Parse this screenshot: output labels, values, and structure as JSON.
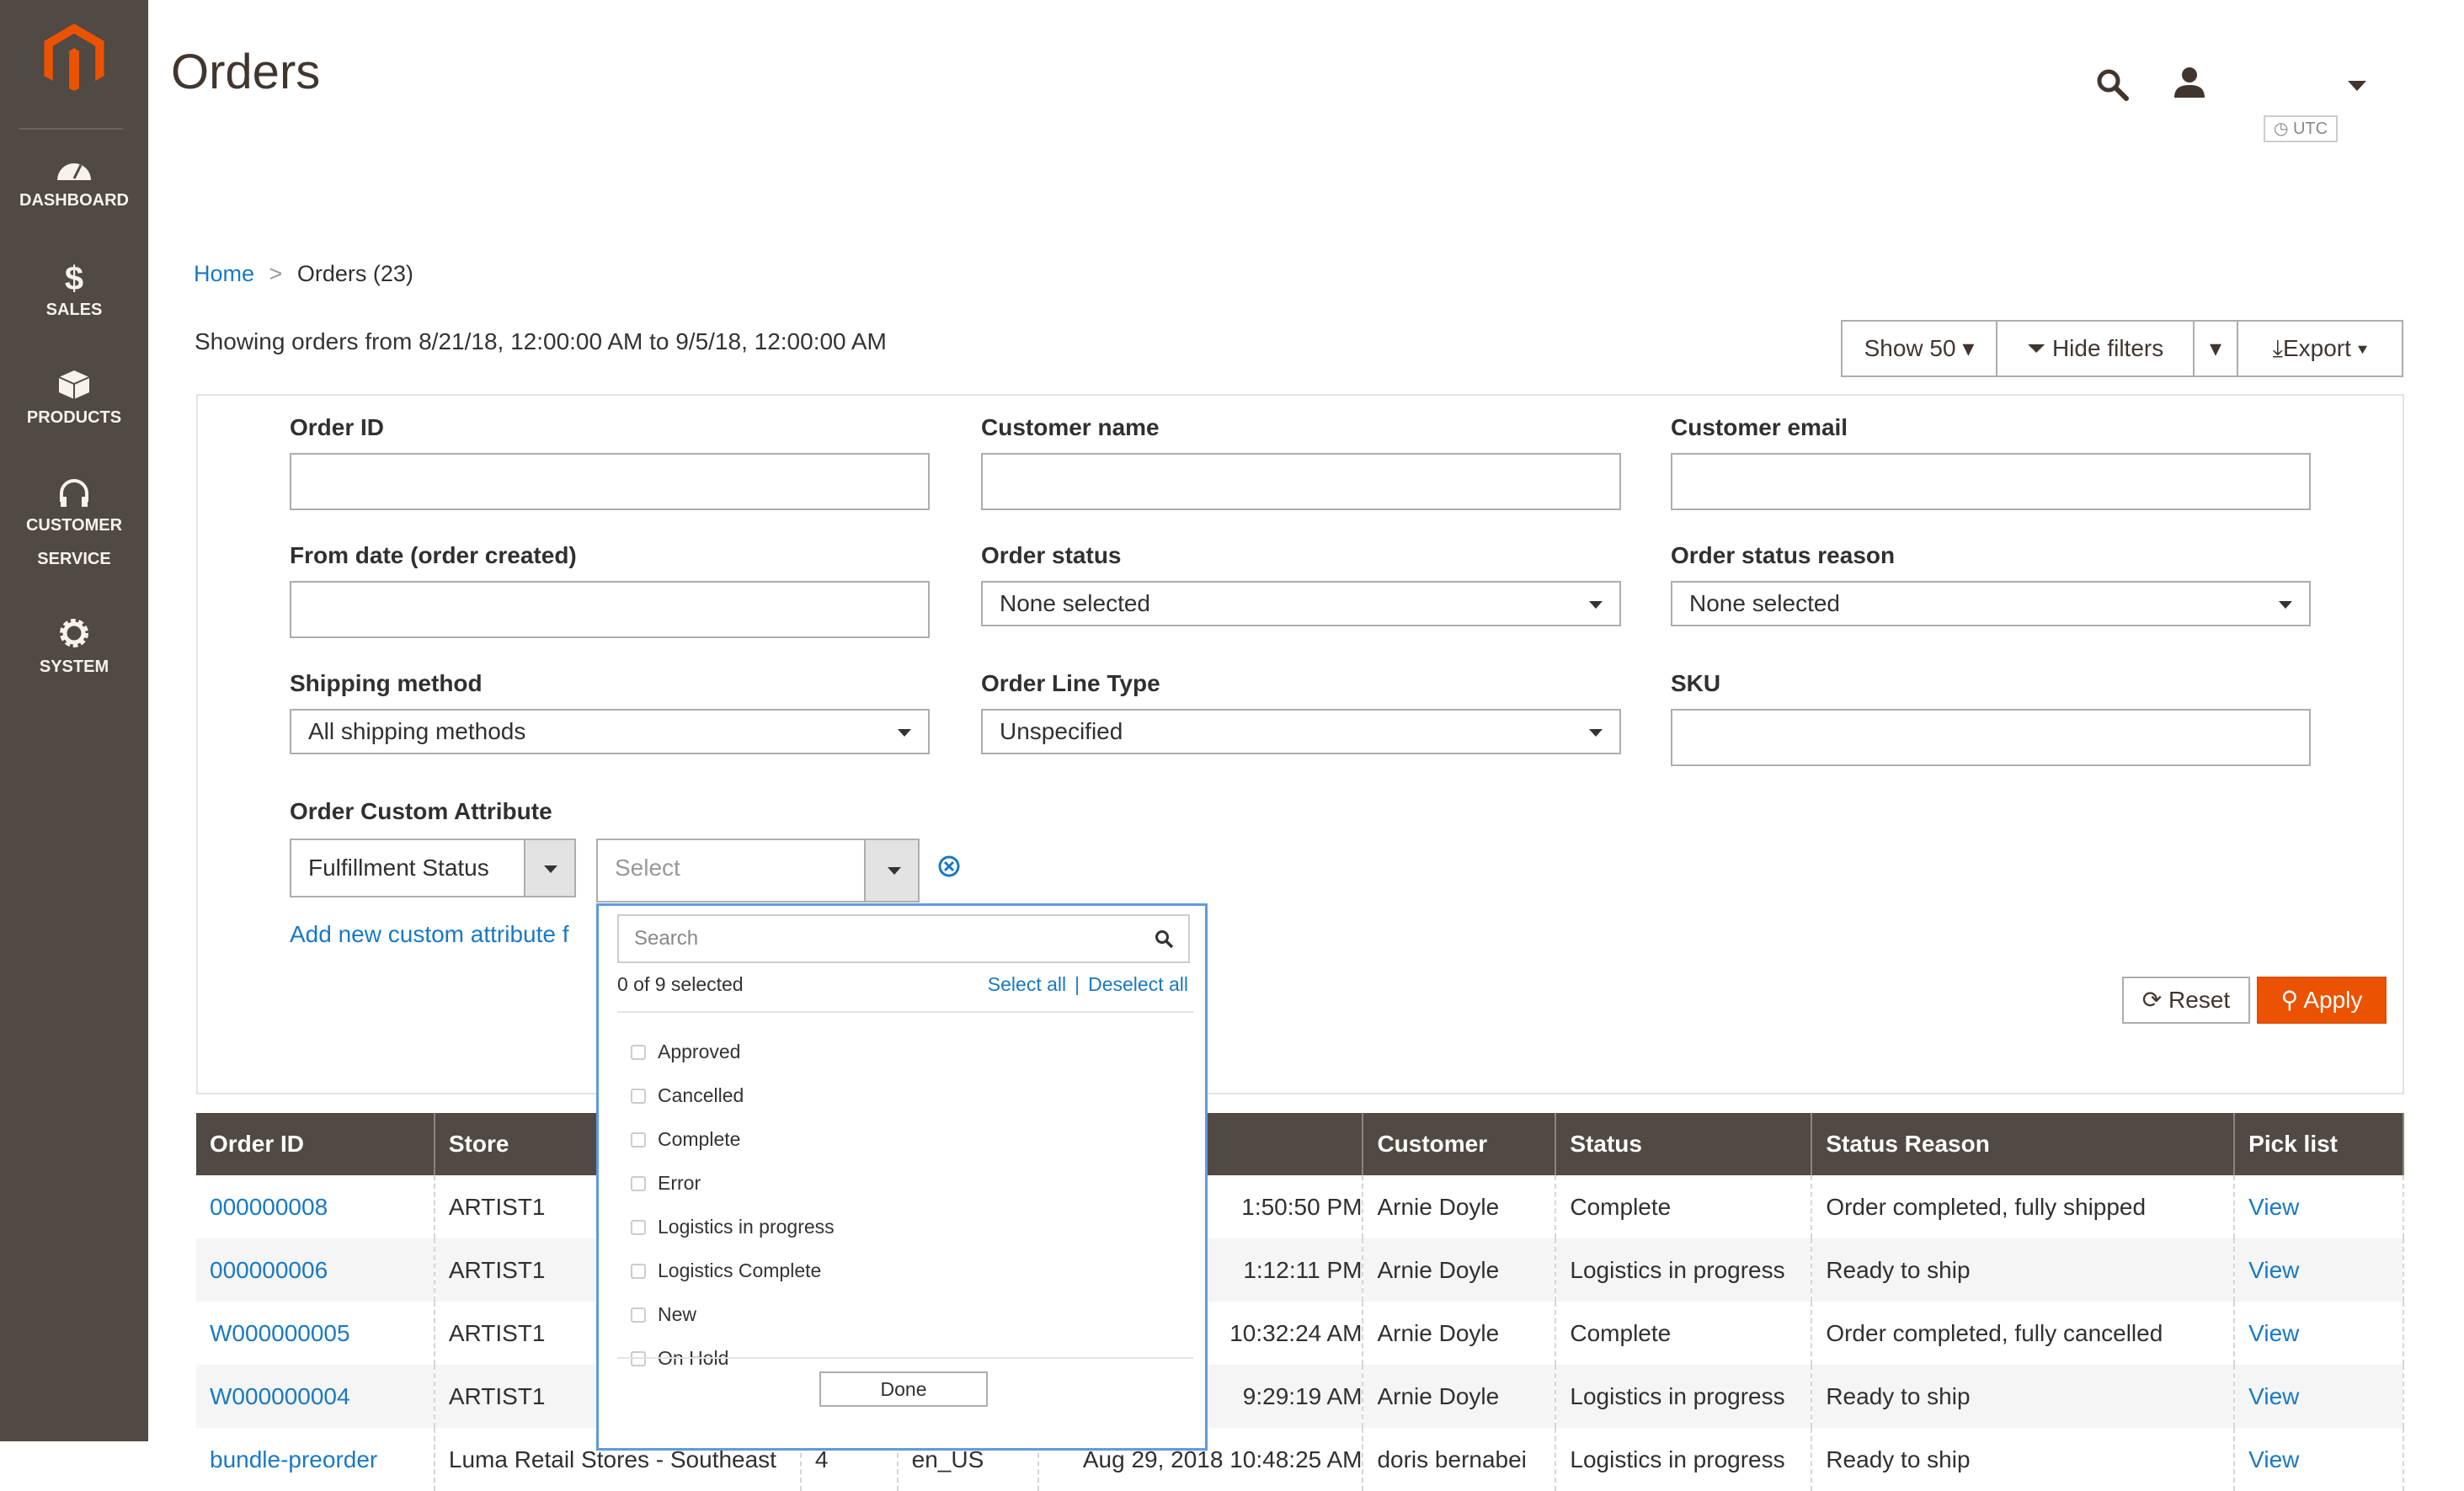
{
  "sidebar": {
    "items": [
      {
        "label": "DASHBOARD",
        "icon": "dashboard-icon"
      },
      {
        "label": "SALES",
        "icon": "dollar-icon"
      },
      {
        "label": "PRODUCTS",
        "icon": "box-icon"
      },
      {
        "label": "CUSTOMER",
        "label2": "SERVICE",
        "icon": "headset-icon"
      },
      {
        "label": "SYSTEM",
        "icon": "gear-icon"
      }
    ]
  },
  "header": {
    "title": "Orders",
    "timezone": "UTC"
  },
  "breadcrumb": {
    "home": "Home",
    "sep": ">",
    "current": "Orders (23)"
  },
  "showing": "Showing orders from 8/21/18, 12:00:00 AM to 9/5/18, 12:00:00 AM",
  "toolbar": {
    "show": "Show 50",
    "hide_filters": "Hide filters",
    "export": "Export"
  },
  "filters": {
    "order_id": "Order ID",
    "customer_name": "Customer name",
    "customer_email": "Customer email",
    "from_date": "From date (order created)",
    "order_status": {
      "label": "Order status",
      "value": "None selected"
    },
    "order_status_reason": {
      "label": "Order status reason",
      "value": "None selected"
    },
    "shipping_method": {
      "label": "Shipping method",
      "value": "All shipping methods"
    },
    "order_line_type": {
      "label": "Order Line Type",
      "value": "Unspecified"
    },
    "sku": "SKU",
    "custom_attr": {
      "label": "Order Custom Attribute",
      "attribute": "Fulfillment Status",
      "value_placeholder": "Select"
    },
    "add_link": "Add new custom attribute f",
    "reset": "Reset",
    "apply": "Apply"
  },
  "dropdown": {
    "search_placeholder": "Search",
    "count": "0 of 9 selected",
    "select_all": "Select all",
    "deselect_all": "Deselect all",
    "options": [
      "Approved",
      "Cancelled",
      "Complete",
      "Error",
      "Logistics in progress",
      "Logistics Complete",
      "New",
      "On Hold"
    ],
    "done": "Done"
  },
  "table": {
    "headers": [
      "Order ID",
      "Store",
      "",
      "",
      "",
      "Customer",
      "Status",
      "Status Reason",
      "Pick list"
    ],
    "rows": [
      [
        "000000008",
        "ARTIST1",
        "",
        "",
        "1:50:50 PM",
        "Arnie Doyle",
        "Complete",
        "Order completed, fully shipped",
        "View"
      ],
      [
        "000000006",
        "ARTIST1",
        "",
        "",
        "1:12:11 PM",
        "Arnie Doyle",
        "Logistics in progress",
        "Ready to ship",
        "View"
      ],
      [
        "W000000005",
        "ARTIST1",
        "",
        "",
        "10:32:24 AM",
        "Arnie Doyle",
        "Complete",
        "Order completed, fully cancelled",
        "View"
      ],
      [
        "W000000004",
        "ARTIST1",
        "",
        "",
        "9:29:19 AM",
        "Arnie Doyle",
        "Logistics in progress",
        "Ready to ship",
        "View"
      ],
      [
        "bundle-preorder",
        "Luma Retail Stores - Southeast",
        "4",
        "en_US",
        "Aug 29, 2018 10:48:25 AM",
        "doris bernabei",
        "Logistics in progress",
        "Ready to ship",
        "View"
      ]
    ]
  },
  "colors": {
    "sidebar": "#514943",
    "accent": "#eb5202",
    "link": "#1979c3",
    "dropdown_border": "#5e9ae0"
  }
}
